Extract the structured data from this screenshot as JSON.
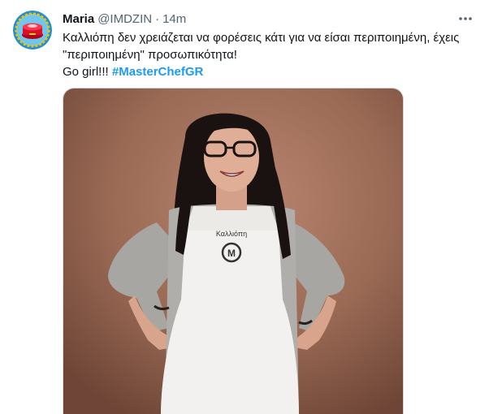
{
  "tweet": {
    "display_name": "Maria",
    "handle": "@IMDZIN",
    "separator": "·",
    "time": "14m",
    "text_lines": [
      "Καλλιόπη δεν χρειάζεται να φορέσεις κάτι για να είσαι περιποιημένη, έχεις",
      "\"περιποιημένη\" προσωπικότητα!"
    ],
    "text_line3_prefix": "Go girl!!! ",
    "hashtag": "#MasterChefGR",
    "avatar_icon": "red-cake-avatar-icon",
    "more_icon": "more-options-icon",
    "media": {
      "apron_name": "Καλλιόπη",
      "apron_logo_letter": "M",
      "background_color": "#9a6a55",
      "apron_color": "#f2f1ef"
    }
  }
}
